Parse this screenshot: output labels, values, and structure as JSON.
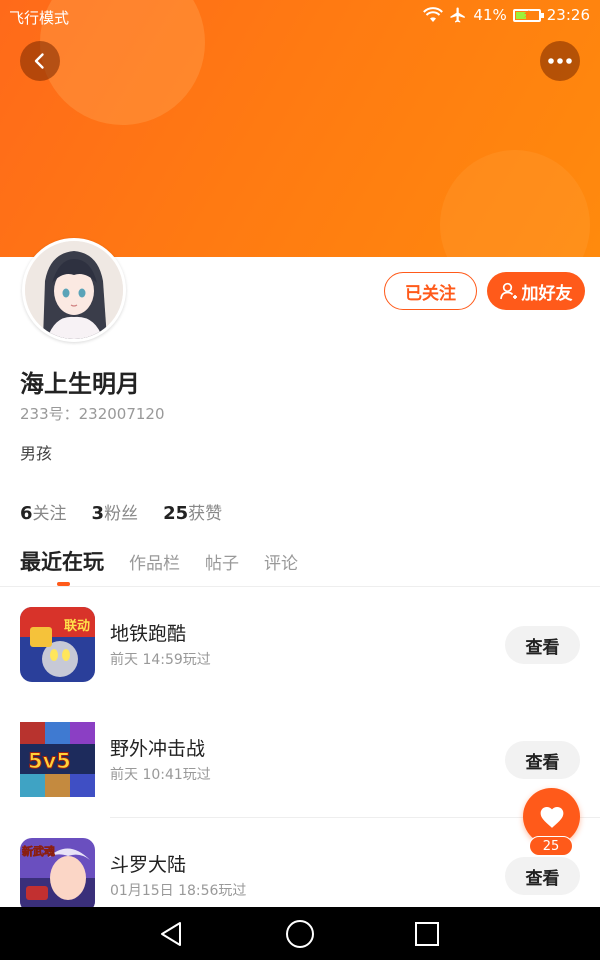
{
  "status_bar": {
    "mode": "飞行模式",
    "battery": "41%",
    "time": "23:26"
  },
  "colors": {
    "accent": "#ff5a1a",
    "banner": "#ff7a12"
  },
  "profile": {
    "name": "海上生明月",
    "id_text": "233号：232007120",
    "bio": "男孩",
    "follow_label": "已关注",
    "add_friend_label": "加好友"
  },
  "stats": [
    {
      "count": "6",
      "label": "关注"
    },
    {
      "count": "3",
      "label": "粉丝"
    },
    {
      "count": "25",
      "label": "获赞"
    }
  ],
  "tabs": [
    "最近在玩",
    "作品栏",
    "帖子",
    "评论"
  ],
  "games": [
    {
      "name": "地铁跑酷",
      "time": "前天 14:59玩过",
      "button": "查看",
      "badge": "联动"
    },
    {
      "name": "野外冲击战",
      "time": "前天 10:41玩过",
      "button": "查看",
      "badge": "5v5"
    },
    {
      "name": "斗罗大陆",
      "time": "01月15日 18:56玩过",
      "button": "查看",
      "badge": "新武魂"
    }
  ],
  "like": {
    "count": "25"
  }
}
